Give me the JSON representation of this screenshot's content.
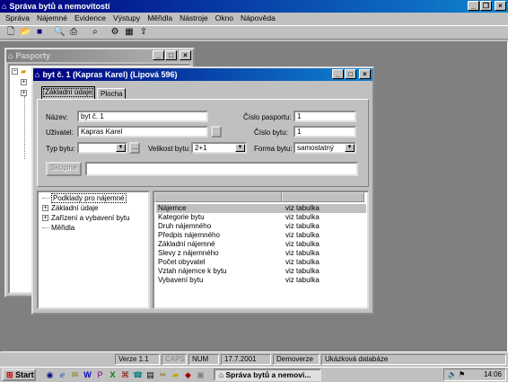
{
  "app": {
    "title": "Správa bytů a nemovitostí",
    "menu": [
      "Správa",
      "Nájemné",
      "Evidence",
      "Výstupy",
      "Měřidla",
      "Nástroje",
      "Okno",
      "Nápověda"
    ],
    "toolbar_icons": [
      "new-icon",
      "open-icon",
      "save-icon",
      "print-preview-icon",
      "print-icon",
      "find-icon",
      "settings-icon",
      "table-icon",
      "export-icon"
    ]
  },
  "pasporty": {
    "title": "Pasporty"
  },
  "dialog": {
    "title": "byt č. 1 (Kapras Karel) (Lipová 596)",
    "tabs": [
      "Základní údaje",
      "Plocha"
    ],
    "nazev_label": "Název:",
    "nazev_value": "byt č. 1",
    "uzivatel_label": "Uživatel:",
    "uzivatel_value": "Kapras Karel",
    "typ_label": "Typ bytu:",
    "typ_value": "",
    "velikost_label": "Velikost bytu:",
    "velikost_value": "2+1",
    "cislo_pasportu_label": "Číslo pasportu:",
    "cislo_pasportu_value": "1",
    "cislo_bytu_label": "Číslo bytu:",
    "cislo_bytu_value": "1",
    "forma_label": "Forma bytu:",
    "forma_value": "samostatný",
    "skupina_label": "Skupina",
    "ellipsis": "...",
    "tree": [
      {
        "label": "Podklady pro nájemné",
        "expandable": false
      },
      {
        "label": "Základní údaje",
        "expandable": true
      },
      {
        "label": "Zařízení a vybavení bytu",
        "expandable": true
      },
      {
        "label": "Měřidla",
        "expandable": false
      }
    ],
    "list": [
      {
        "name": "Nájemce",
        "value": "viz tabulka"
      },
      {
        "name": "Kategorie bytu",
        "value": "viz tabulka"
      },
      {
        "name": "Druh nájemného",
        "value": "viz tabulka"
      },
      {
        "name": "Předpis nájemného",
        "value": "viz tabulka"
      },
      {
        "name": "Základní nájemné",
        "value": "viz tabulka"
      },
      {
        "name": "Slevy z nájemného",
        "value": "viz tabulka"
      },
      {
        "name": "Počet obyvatel",
        "value": "viz tabulka"
      },
      {
        "name": "Vztah nájemce k bytu",
        "value": "viz tabulka"
      },
      {
        "name": "Vybavení bytu",
        "value": "viz tabulka"
      }
    ]
  },
  "status": {
    "version": "Verze 1.1",
    "caps": "CAPS",
    "num": "NUM",
    "date": "17.7.2001",
    "mode": "Demoverze",
    "database": "Ukázková databáze"
  },
  "taskbar": {
    "start": "Start",
    "task": "Správa bytů a nemovi...",
    "clock": "14:06"
  }
}
